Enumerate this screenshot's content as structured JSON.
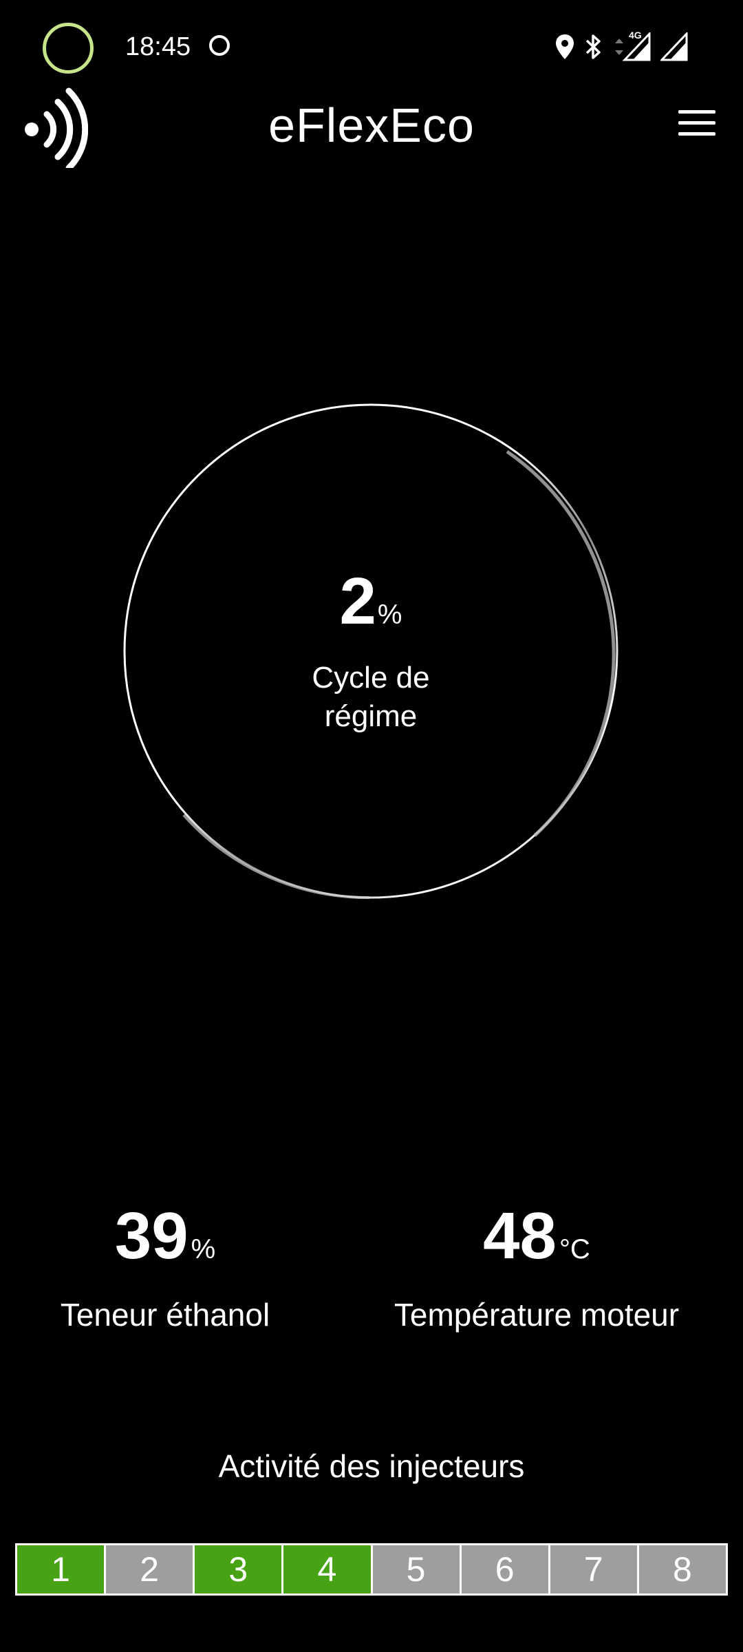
{
  "status_bar": {
    "time": "18:45",
    "network": "4G",
    "icons": [
      "location-icon",
      "bluetooth-icon",
      "signal-4g-icon",
      "signal-icon"
    ]
  },
  "app_bar": {
    "title": "eFlexEco",
    "connect_icon": "nfc-connection-icon",
    "menu_icon": "hamburger-menu-icon"
  },
  "gauge": {
    "value": "2",
    "unit": "%",
    "label": "Cycle de régime",
    "level": 0.02
  },
  "readouts": {
    "ethanol": {
      "value": "39",
      "unit": "%",
      "label": "Teneur éthanol"
    },
    "temperature": {
      "value": "48",
      "unit": "°C",
      "label": "Température moteur"
    }
  },
  "injectors": {
    "title": "Activité des injecteurs",
    "items": [
      {
        "label": "1",
        "active": true
      },
      {
        "label": "2",
        "active": false
      },
      {
        "label": "3",
        "active": true
      },
      {
        "label": "4",
        "active": true
      },
      {
        "label": "5",
        "active": false
      },
      {
        "label": "6",
        "active": false
      },
      {
        "label": "7",
        "active": false
      },
      {
        "label": "8",
        "active": false
      }
    ]
  },
  "colors": {
    "background": "#000000",
    "active_injector": "#47a314",
    "inactive_injector": "#9e9e9e",
    "status_ring": "#c6e58a"
  }
}
